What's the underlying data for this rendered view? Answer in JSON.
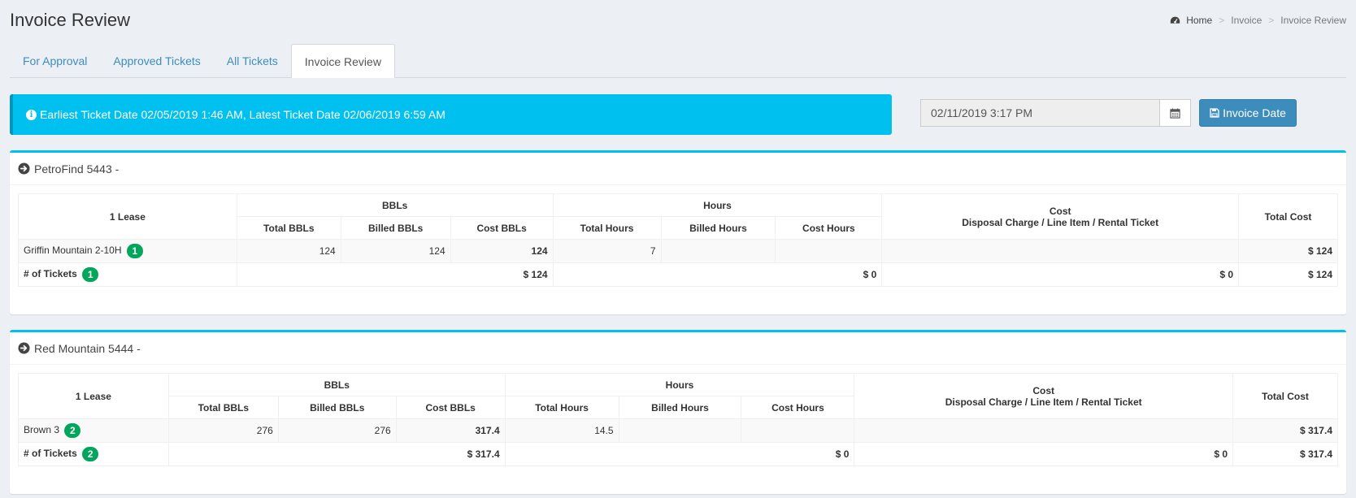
{
  "page": {
    "title": "Invoice Review"
  },
  "breadcrumb": {
    "home": "Home",
    "items": [
      "Invoice",
      "Invoice Review"
    ]
  },
  "tabs": [
    "For Approval",
    "Approved Tickets",
    "All Tickets",
    "Invoice Review"
  ],
  "alert": {
    "text": "Earliest Ticket Date 02/05/2019 1:46 AM, Latest Ticket Date 02/06/2019 6:59 AM"
  },
  "invoice_date": {
    "value": "02/11/2019 3:17 PM",
    "button_label": "Invoice Date"
  },
  "headers": {
    "bbls": "BBLs",
    "hours": "Hours",
    "cost": "Cost",
    "cost_sub": "Disposal Charge / Line Item / Rental Ticket",
    "total_cost": "Total Cost",
    "total_bbls": "Total BBLs",
    "billed_bbls": "Billed BBLs",
    "cost_bbls": "Cost BBLs",
    "total_hours": "Total Hours",
    "billed_hours": "Billed Hours",
    "cost_hours": "Cost Hours",
    "tickets_label": "# of Tickets"
  },
  "panels": [
    {
      "title": "PetroFind 5443 -",
      "lease_header": "1 Lease",
      "row": {
        "lease": "Griffin Mountain 2-10H",
        "badge": "1",
        "total_bbls": "124",
        "billed_bbls": "124",
        "cost_bbls": "124",
        "total_hours": "7",
        "billed_hours": "",
        "cost_hours": "",
        "cost": "",
        "total_cost": "$ 124"
      },
      "totals": {
        "badge": "1",
        "bbls": "$ 124",
        "hours": "$ 0",
        "cost": "$ 0",
        "total_cost": "$ 124"
      }
    },
    {
      "title": "Red Mountain 5444 -",
      "lease_header": "1 Lease",
      "row": {
        "lease": "Brown 3",
        "badge": "2",
        "total_bbls": "276",
        "billed_bbls": "276",
        "cost_bbls": "317.4",
        "total_hours": "14.5",
        "billed_hours": "",
        "cost_hours": "",
        "cost": "",
        "total_cost": "$ 317.4"
      },
      "totals": {
        "badge": "2",
        "bbls": "$ 317.4",
        "hours": "$ 0",
        "cost": "$ 0",
        "total_cost": "$ 317.4"
      }
    }
  ]
}
